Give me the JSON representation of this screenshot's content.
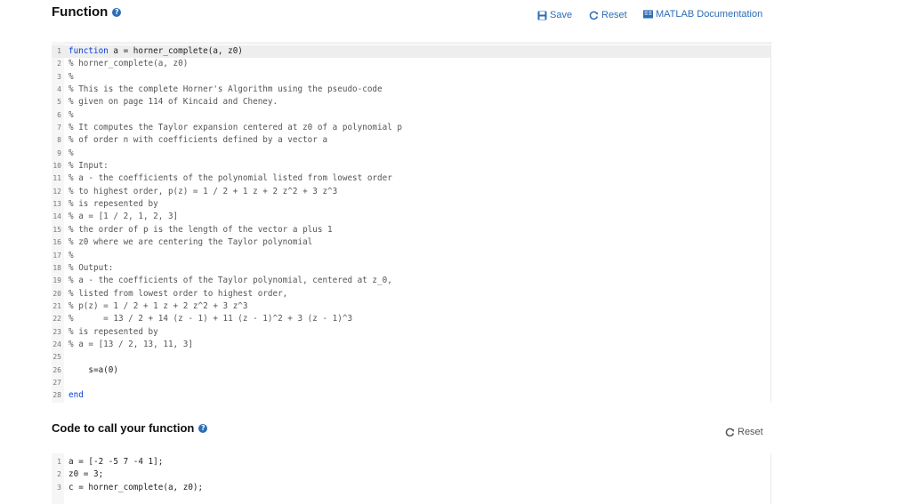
{
  "function_section": {
    "title": "Function",
    "help": "?",
    "toolbar": {
      "save_label": "Save",
      "reset_label": "Reset",
      "doc_label": "MATLAB Documentation"
    },
    "lines": [
      {
        "n": "1",
        "kw": "function",
        "rest": " a = horner_complete(a, z0)"
      },
      {
        "n": "2",
        "text": "% horner_complete(a, z0)"
      },
      {
        "n": "3",
        "text": "%"
      },
      {
        "n": "4",
        "text": "% This is the complete Horner's Algorithm using the pseudo-code"
      },
      {
        "n": "5",
        "text": "% given on page 114 of Kincaid and Cheney."
      },
      {
        "n": "6",
        "text": "%"
      },
      {
        "n": "7",
        "text": "% It computes the Taylor expansion centered at z0 of a polynomial p"
      },
      {
        "n": "8",
        "text": "% of order n with coefficients defined by a vector a"
      },
      {
        "n": "9",
        "text": "%"
      },
      {
        "n": "10",
        "text": "% Input:"
      },
      {
        "n": "11",
        "text": "% a - the coefficients of the polynomial listed from lowest order"
      },
      {
        "n": "12",
        "text": "% to highest order, p(z) = 1 / 2 + 1 z + 2 z^2 + 3 z^3"
      },
      {
        "n": "13",
        "text": "% is repesented by"
      },
      {
        "n": "14",
        "text": "% a = [1 / 2, 1, 2, 3]"
      },
      {
        "n": "15",
        "text": "% the order of p is the length of the vector a plus 1"
      },
      {
        "n": "16",
        "text": "% z0 where we are centering the Taylor polynomial"
      },
      {
        "n": "17",
        "text": "%"
      },
      {
        "n": "18",
        "text": "% Output:"
      },
      {
        "n": "19",
        "text": "% a - the coefficients of the Taylor polynomial, centered at z_0,"
      },
      {
        "n": "20",
        "text": "% listed from lowest order to highest order,"
      },
      {
        "n": "21",
        "text": "% p(z) = 1 / 2 + 1 z + 2 z^2 + 3 z^3"
      },
      {
        "n": "22",
        "text": "%      = 13 / 2 + 14 (z - 1) + 11 (z - 1)^2 + 3 (z - 1)^3"
      },
      {
        "n": "23",
        "text": "% is repesented by"
      },
      {
        "n": "24",
        "text": "% a = [13 / 2, 13, 11, 3]"
      },
      {
        "n": "25",
        "text": ""
      },
      {
        "n": "26",
        "text": "    s=a(0)"
      },
      {
        "n": "27",
        "text": ""
      },
      {
        "n": "28",
        "kw": "end",
        "rest": ""
      }
    ]
  },
  "call_section": {
    "title": "Code to call your function",
    "help": "?",
    "reset_label": "Reset",
    "lines": [
      {
        "n": "1",
        "text": "a = [-2 -5 7 -4 1];"
      },
      {
        "n": "2",
        "text": "z0 = 3;"
      },
      {
        "n": "3",
        "text": "c = horner_complete(a, z0);"
      }
    ]
  },
  "colors": {
    "link": "#2d6db5",
    "keyword": "#0a3fd6",
    "active_line": "#eeeeee"
  }
}
